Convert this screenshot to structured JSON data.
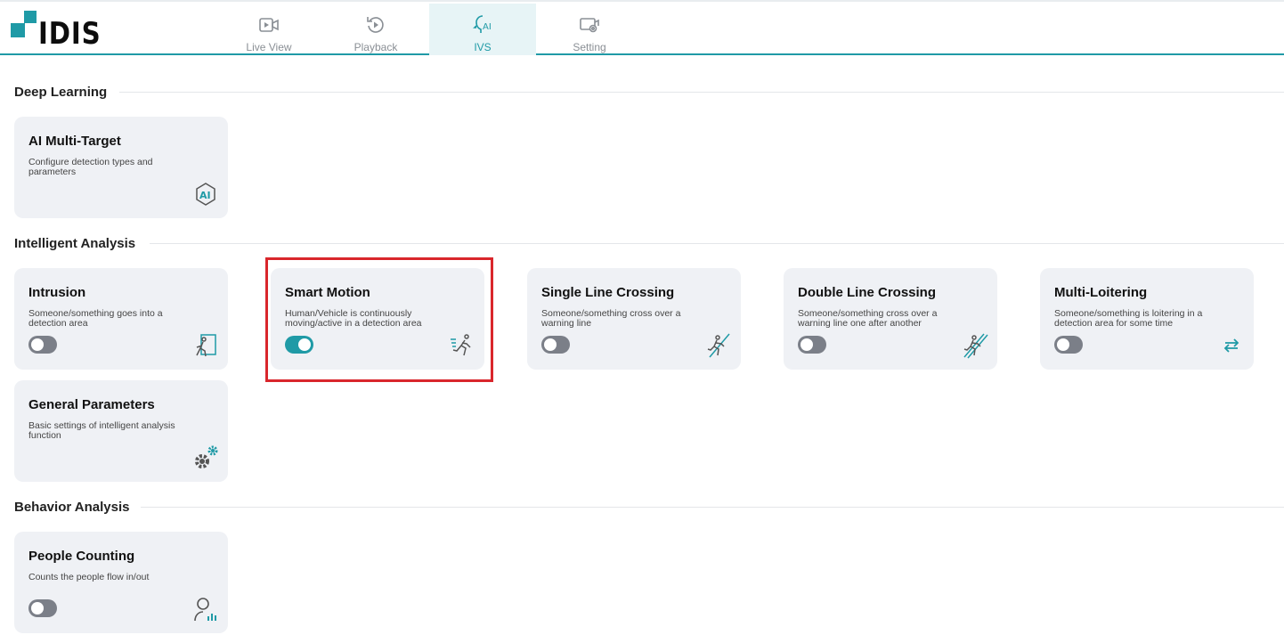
{
  "app": {
    "logo_text": "IDIS",
    "accent": "#1f9aa6"
  },
  "nav": {
    "tabs": [
      {
        "label": "Live View",
        "icon": "video-icon",
        "active": false
      },
      {
        "label": "Playback",
        "icon": "playback-icon",
        "active": false
      },
      {
        "label": "IVS",
        "icon": "ai-head-icon",
        "active": true
      },
      {
        "label": "Setting",
        "icon": "settings-camera-icon",
        "active": false
      }
    ]
  },
  "sections": {
    "deep_learning": "Deep Learning",
    "intelligent_analysis": "Intelligent Analysis",
    "behavior_analysis": "Behavior Analysis"
  },
  "cards": {
    "ai_multi_target": {
      "title": "AI Multi-Target",
      "desc": "Configure detection types and parameters",
      "icon": "ai-icon"
    },
    "intrusion": {
      "title": "Intrusion",
      "desc": "Someone/something goes into a detection area",
      "icon": "intrusion-icon",
      "enabled": false
    },
    "smart_motion": {
      "title": "Smart Motion",
      "desc": "Human/Vehicle is continuously moving/active in a detection area",
      "icon": "running-person-icon",
      "enabled": true
    },
    "single_line": {
      "title": "Single Line Crossing",
      "desc": "Someone/something cross over a warning line",
      "icon": "line-crossing-icon",
      "enabled": false
    },
    "double_line": {
      "title": "Double Line Crossing",
      "desc": "Someone/something cross over a warning line one after another",
      "icon": "double-line-crossing-icon",
      "enabled": false
    },
    "multi_loitering": {
      "title": "Multi-Loitering",
      "desc": "Someone/something is loitering in a detection area for some time",
      "icon": "loitering-arrows-icon",
      "enabled": false
    },
    "general_parameters": {
      "title": "General Parameters",
      "desc": "Basic settings of intelligent analysis function",
      "icon": "gears-icon"
    },
    "people_counting": {
      "title": "People Counting",
      "desc": "Counts the people flow in/out",
      "icon": "people-counting-icon",
      "enabled": false
    }
  }
}
